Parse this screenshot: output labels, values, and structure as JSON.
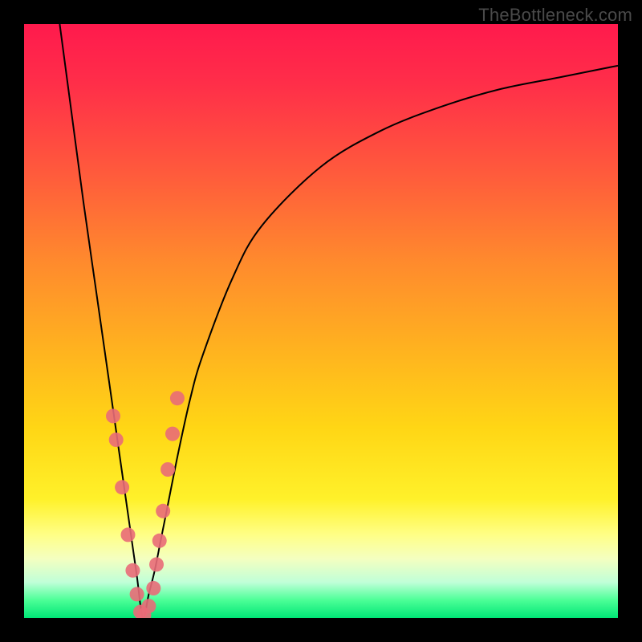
{
  "watermark": "TheBottleneck.com",
  "chart_data": {
    "type": "line",
    "title": "",
    "xlabel": "",
    "ylabel": "",
    "xlim": [
      0,
      100
    ],
    "ylim": [
      0,
      100
    ],
    "annotations": [],
    "series": [
      {
        "name": "curve",
        "x": [
          6,
          8,
          10,
          12,
          14,
          15,
          16,
          17,
          18,
          19,
          20,
          21,
          22,
          23,
          24,
          26,
          28,
          30,
          35,
          40,
          50,
          60,
          70,
          80,
          90,
          100
        ],
        "y": [
          100,
          85,
          70,
          56,
          42,
          35,
          28,
          21,
          14,
          7,
          0,
          4,
          8,
          13,
          18,
          28,
          37,
          44,
          57,
          66,
          76,
          82,
          86,
          89,
          91,
          93
        ]
      },
      {
        "name": "highlight-dots",
        "x": [
          15.0,
          15.5,
          16.5,
          17.5,
          18.3,
          19.0,
          19.6,
          20.2,
          21.0,
          21.8,
          22.3,
          22.8,
          23.4,
          24.2,
          25.0,
          25.8
        ],
        "y": [
          34,
          30,
          22,
          14,
          8,
          4,
          1,
          0.5,
          2,
          5,
          9,
          13,
          18,
          25,
          31,
          37
        ]
      }
    ],
    "colors": {
      "curve": "#000000",
      "dots": "#e96b78",
      "gradient_top": "#ff1a4d",
      "gradient_mid": "#ffd615",
      "gradient_bottom": "#00e676",
      "frame": "#000000"
    }
  }
}
